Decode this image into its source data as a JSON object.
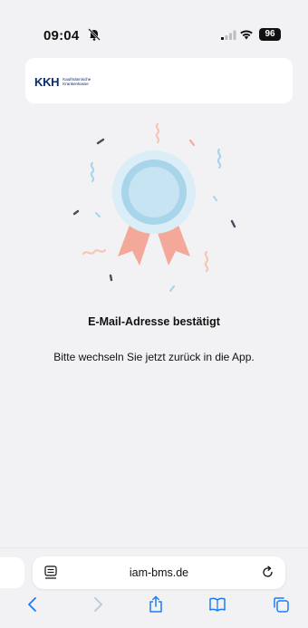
{
  "status": {
    "time": "09:04",
    "battery": "96"
  },
  "header": {
    "logo_mark": "KKH",
    "logo_line1": "Kaufmännische",
    "logo_line2": "Krankenkasse"
  },
  "main": {
    "title": "E-Mail-Adresse bestätigt",
    "message": "Bitte wechseln Sie jetzt zurück in die App."
  },
  "browser": {
    "url": "iam-bms.de"
  },
  "colors": {
    "badge_outer": "#dbeef7",
    "badge_ring": "#a9d5ea",
    "badge_inner": "#c6e4f2",
    "ribbon": "#f4a89a",
    "accent_blue": "#1a7cf5",
    "logo": "#0b2b6b"
  },
  "icons": {
    "mute": "bell-slash-icon",
    "signal": "signal-icon",
    "wifi": "wifi-icon",
    "page": "page-menu-icon",
    "reload": "reload-icon",
    "back": "chevron-left-icon",
    "forward": "chevron-right-icon",
    "share": "share-icon",
    "bookmarks": "book-icon",
    "tabs": "tabs-icon"
  }
}
